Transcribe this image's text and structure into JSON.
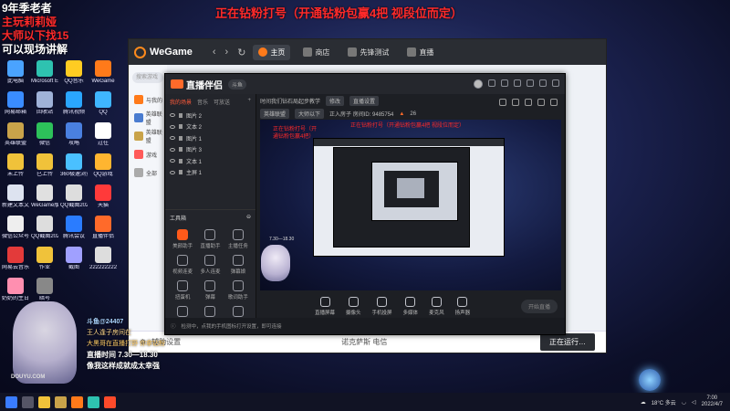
{
  "overlay": {
    "line1": "9年季老者",
    "line2": "主玩莉莉娅",
    "line3": "大师以下找15",
    "line4": "可以现场讲解",
    "top_banner": "正在钻粉打号（开通钻粉包赢4把 视段位而定）"
  },
  "desktop": {
    "icons": [
      {
        "label": "此电脑",
        "color": "#4aa3ff"
      },
      {
        "label": "Microsoft Edge",
        "color": "#2ec2b0"
      },
      {
        "label": "QQ音乐",
        "color": "#ffcc22"
      },
      {
        "label": "WeGame",
        "color": "#ff7a1a"
      },
      {
        "label": "网易邮箱",
        "color": "#3a8cff"
      },
      {
        "label": "回收站",
        "color": "#9fb2d8"
      },
      {
        "label": "腾讯视频",
        "color": "#2aa6ff"
      },
      {
        "label": "QQ",
        "color": "#3fb6ff"
      },
      {
        "label": "英雄联盟",
        "color": "#c9a34a"
      },
      {
        "label": "微信",
        "color": "#2dc15a"
      },
      {
        "label": "攻略",
        "color": "#4a80e0"
      },
      {
        "label": "过往",
        "color": "#ffffff"
      },
      {
        "label": "未上传",
        "color": "#f0c23a"
      },
      {
        "label": "已上传",
        "color": "#f0c23a"
      },
      {
        "label": "360极速浏览器",
        "color": "#4ac0ff"
      },
      {
        "label": "QQ游戏",
        "color": "#ffb530"
      },
      {
        "label": "新建文本文档",
        "color": "#dde3f0"
      },
      {
        "label": "WeGame版",
        "color": "#e0e0e0"
      },
      {
        "label": "QQ截图20220115...",
        "color": "#ddd"
      },
      {
        "label": "天猫",
        "color": "#ff3a3a"
      },
      {
        "label": "微信公众号",
        "color": "#eee"
      },
      {
        "label": "QQ截图20211130...",
        "color": "#ddd"
      },
      {
        "label": "腾讯会议",
        "color": "#2a7cff"
      },
      {
        "label": "直播伴侣",
        "color": "#ff6a2a"
      },
      {
        "label": "网易云音乐",
        "color": "#e33a3a"
      },
      {
        "label": "作业",
        "color": "#f0c23a"
      },
      {
        "label": "截图",
        "color": "#a0a0ff"
      },
      {
        "label": "222222222",
        "color": "#ddd"
      },
      {
        "label": "奶奶的生日",
        "color": "#ff8fb0"
      },
      {
        "label": "暗号",
        "color": "#888"
      }
    ]
  },
  "wegame": {
    "logo": "WeGame",
    "tabs": [
      {
        "label": "主页",
        "active": true
      },
      {
        "label": "商店",
        "active": false
      },
      {
        "label": "先锋测试",
        "active": false
      },
      {
        "label": "直播",
        "active": false
      }
    ],
    "search_placeholder": "搜索游戏",
    "side_items": [
      {
        "label": "与我的",
        "color": "#ff7a1a"
      },
      {
        "label": "英雄联盟",
        "color": "#4a7cd0"
      },
      {
        "label": "英雄联盟",
        "color": "#c9a34a"
      },
      {
        "label": "游戏",
        "color": "#ff5a5a"
      },
      {
        "label": "全部",
        "color": "#aaa"
      }
    ],
    "footer_label": "辅助设置",
    "server": "诺克萨斯 电信",
    "start_button": "正在运行…"
  },
  "zbhb": {
    "logo": "直播伴侣",
    "logo_sub": "斗鱼",
    "tabs": [
      "我的场景",
      "音乐",
      "可放送"
    ],
    "scenes": [
      "图片 2",
      "文本 2",
      "图片 1",
      "图片 3",
      "文本 1",
      "主屏 1"
    ],
    "red_text": "正在钻粉打号（开通钻粉包赢4把）",
    "room_title": "时间我们钻石局起步教学",
    "room_tag1": "修改",
    "room_tag2": "直播设置",
    "room_category": "英雄联盟",
    "room_category2": "大师以下",
    "room_id": "正入房子 房间ID: 9485754",
    "room_hot": "26",
    "preview_banner": "正在钻粉打号（开通钻粉包赢4把 视段位而定）",
    "tools_title": "工具箱",
    "tools": [
      "美颜助手",
      "直播助手",
      "主播任务",
      "视频连麦",
      "多人连麦",
      "弹幕娘",
      "扭蛋机",
      "弹幕",
      "歌词助手",
      "更多工具",
      "主播PK",
      "礼物展示"
    ],
    "bottom_actions": [
      "直播屏幕",
      "摄像头",
      "手机投屏",
      "多媒体",
      "麦克风",
      "扬声器"
    ],
    "start_button": "开始直播",
    "status": "检测中，点我的手机图标打开设置，即可连接"
  },
  "chat": {
    "line1": "斗鱼@24407",
    "line2": "王人逢子房间在",
    "line3": "大黑哥在直播打野 你拿钻粉",
    "line4": "直播时间  7.30—18.30",
    "line5": "像我这样成就成太幸强"
  },
  "watermark": "DOUYU.COM",
  "taskbar": {
    "weather": "18°C 多云",
    "time": "7:00",
    "date": "2022/4/7"
  }
}
